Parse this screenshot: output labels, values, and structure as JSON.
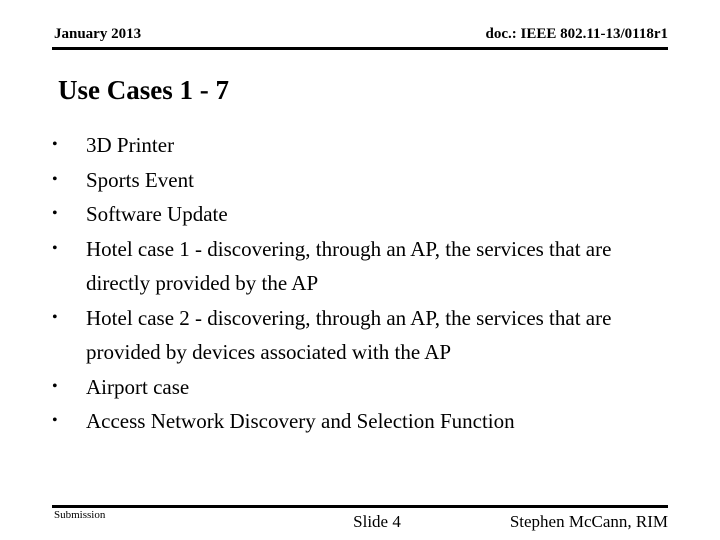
{
  "header": {
    "date": "January 2013",
    "doc": "doc.: IEEE 802.11-13/0118r1"
  },
  "title": "Use Cases 1 - 7",
  "bullets": [
    {
      "marker": "•",
      "text": "3D Printer"
    },
    {
      "marker": "•",
      "text": "Sports Event"
    },
    {
      "marker": "•",
      "text": "Software Update"
    },
    {
      "marker": "•",
      "text": "Hotel case 1 - discovering, through an AP, the services that are directly provided by the AP"
    },
    {
      "marker": "•",
      "text": "Hotel case 2 - discovering, through an AP, the services that are provided by devices associated with the AP"
    },
    {
      "marker": "•",
      "text": "Airport case"
    },
    {
      "marker": "•",
      "text": "Access Network Discovery and Selection Function"
    }
  ],
  "footer": {
    "submission": "Submission",
    "slide": "Slide 4",
    "author": "Stephen McCann, RIM"
  },
  "colors": {
    "text": "#000000",
    "background": "#ffffff",
    "rule": "#000000"
  }
}
